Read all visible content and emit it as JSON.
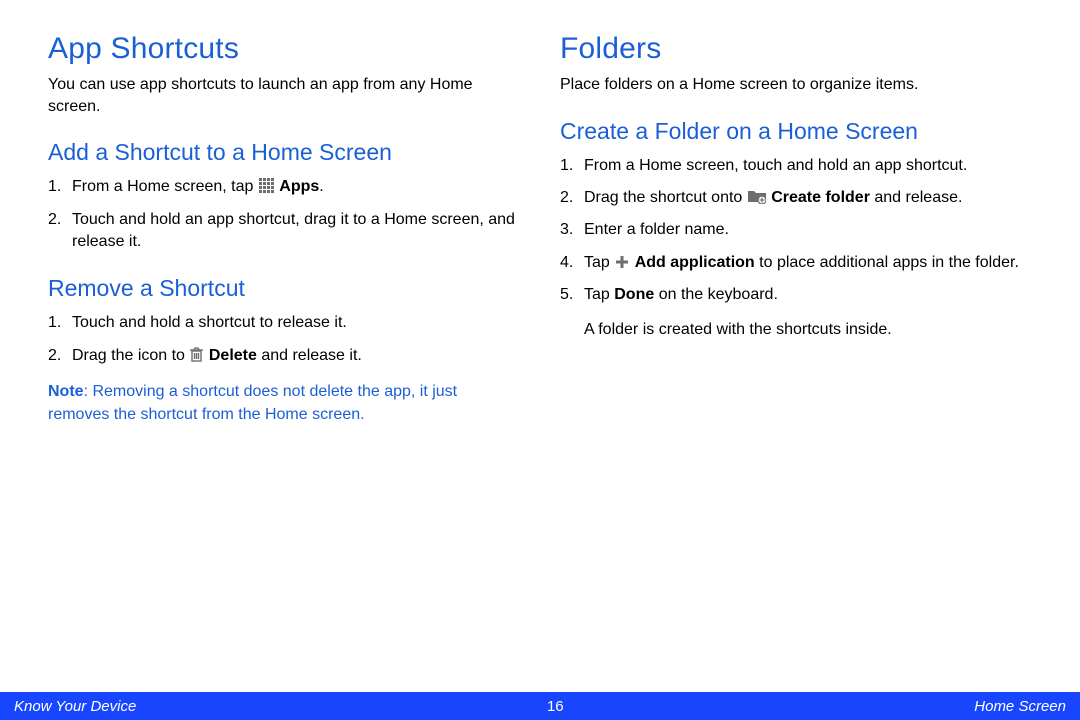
{
  "left": {
    "h1": "App Shortcuts",
    "intro": "You can use app shortcuts to launch an app from any Home screen.",
    "sec1": {
      "h2": "Add a Shortcut to a Home Screen",
      "step1a": "From a Home screen, tap ",
      "step1b": "Apps",
      "step1c": ".",
      "step2": "Touch and hold an app shortcut, drag it to a Home screen, and release it."
    },
    "sec2": {
      "h2": "Remove a Shortcut",
      "step1": "Touch and hold a shortcut to release it.",
      "step2a": "Drag the icon to ",
      "step2b": "Delete",
      "step2c": " and release it.",
      "note_label": "Note",
      "note_body": ": Removing a shortcut does not delete the app, it just removes the shortcut from the Home screen."
    }
  },
  "right": {
    "h1": "Folders",
    "intro": "Place folders on a Home screen to organize items.",
    "sec1": {
      "h2": "Create a Folder on a Home Screen",
      "step1": "From a Home screen, touch and hold an app shortcut.",
      "step2a": "Drag the shortcut onto ",
      "step2b": "Create folder",
      "step2c": " and release.",
      "step3": "Enter a folder name.",
      "step4a": "Tap ",
      "step4b": "Add application",
      "step4c": " to place additional apps in the folder.",
      "step5a": "Tap ",
      "step5b": "Done",
      "step5c": " on the keyboard.",
      "after": "A folder is created with the shortcuts inside."
    }
  },
  "footer": {
    "left": "Know Your Device",
    "page": "16",
    "right": "Home Screen"
  },
  "nums": {
    "n1": "1.",
    "n2": "2.",
    "n3": "3.",
    "n4": "4.",
    "n5": "5."
  }
}
